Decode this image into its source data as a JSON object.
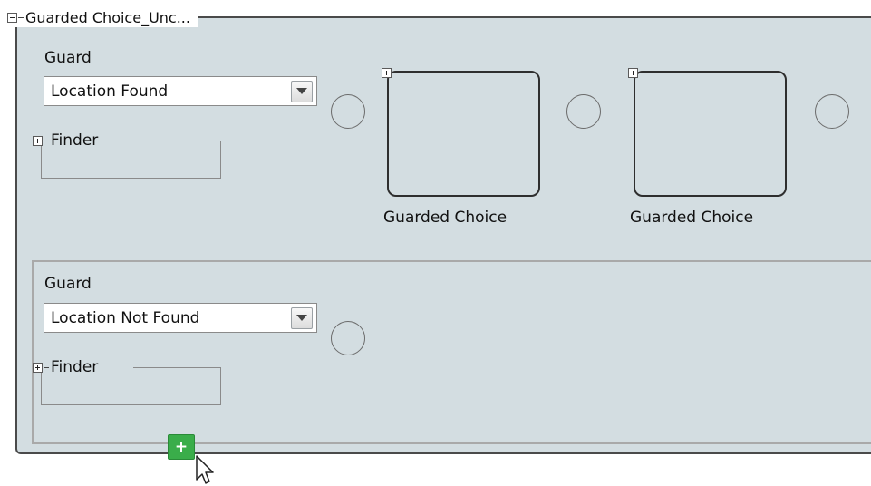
{
  "outer": {
    "title": "Guarded Choice_Unc..."
  },
  "branch1": {
    "guard_label": "Guard",
    "guard_value": "Location Found",
    "finder_label": "Finder",
    "choices": [
      {
        "label": "Guarded Choice"
      },
      {
        "label": "Guarded Choice"
      }
    ]
  },
  "branch2": {
    "guard_label": "Guard",
    "guard_value": "Location Not Found",
    "finder_label": "Finder"
  },
  "add_button": {
    "label": "+"
  },
  "colors": {
    "panel_bg": "#d3dde1",
    "add_button": "#3aad4a"
  }
}
